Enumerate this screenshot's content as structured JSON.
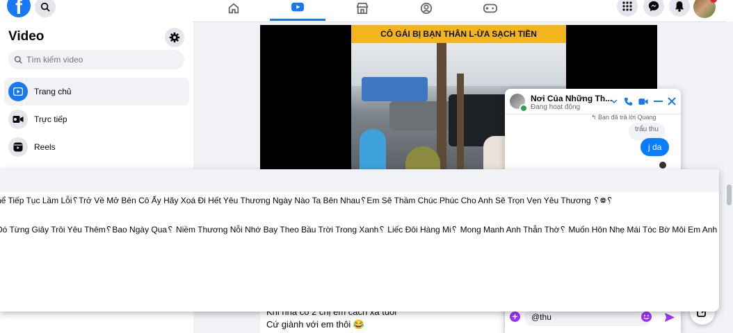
{
  "topbar": {
    "nav_tabs": [
      "home-icon",
      "video-icon",
      "marketplace-icon",
      "groups-icon",
      "gaming-icon"
    ],
    "active_tab": "video-icon"
  },
  "sidebar": {
    "title": "Video",
    "search_placeholder": "Tìm kiếm video",
    "items": [
      {
        "label": "Trang chủ",
        "icon": "play-icon"
      },
      {
        "label": "Trực tiếp",
        "icon": "live-camera-icon"
      },
      {
        "label": "Reels",
        "icon": "reels-icon"
      }
    ]
  },
  "video": {
    "banner": "CÔ GÁI BỊ BẠN THÂN L-ỪA SẠCH TIỀN"
  },
  "comment": {
    "line1": "Khi nha co 2 chị em cách xa tuổi",
    "line2": "Cứ giành với em thôi 😂"
  },
  "chat": {
    "name": "Nơi Của Những Th...",
    "status": "Đang hoạt động",
    "reply_note": "↰ Bạn đã trả lời Quang",
    "quoted": "trẩu thu",
    "bubble": "j da",
    "input_value": "@thu"
  },
  "overlay": {
    "line1": "hể Tiếp Tục Lầm Lỗi␦Trở Về Mở Bên Cô Ấy Hãy Xoá Đi Hết Yêu Thương Ngày Nào Ta Bên Nhau␦Em Sẽ Thầm Chúc Phúc Cho Anh Sẽ Trọn Vẹn Yêu Thương ␦❁␦",
    "line2": " Đó Từng Giây Trôi Yêu Thêm␦Bao Ngày Qua␦ Niềm Thương Nỗi Nhớ Bay Theo Bầu Trời Trong Xanh␦ Liếc Đôi Hàng Mi␦ Mong Manh Anh Thẫn Thờ␦ Muốn Hôn Nhẹ Mái Tóc Bờ Môi Em Anh Mơ␦❁␦"
  },
  "colors": {
    "brand": "#1877f2",
    "messenger_bubble": "#0a7cff",
    "composer_accent": "#a033ff",
    "banner": "#f2b51d"
  }
}
